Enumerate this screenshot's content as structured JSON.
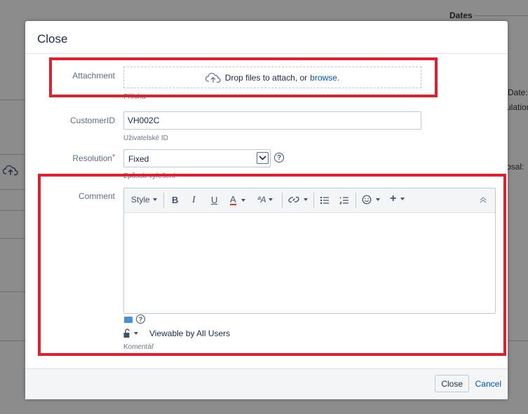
{
  "background": {
    "dates_label": "Dates",
    "date_partial": "Date:",
    "simul_partial": "ulation",
    "posal_partial": "osal:"
  },
  "dialog": {
    "title": "Close",
    "attachment": {
      "label": "Attachment",
      "drop_text": "Drop files to attach, or",
      "browse_link": "browse.",
      "hint": "Příloha"
    },
    "customer_id": {
      "label": "CustomerID",
      "value": "VH002C",
      "hint": "Uživatelské ID"
    },
    "resolution": {
      "label": "Resolution",
      "required_marker": "*",
      "selected": "Fixed",
      "hint": "Způsob vyřešení"
    },
    "comment": {
      "label": "Comment",
      "toolbar": {
        "style_label": "Style",
        "bold": "B",
        "italic": "I",
        "underline": "U",
        "text_color": "A",
        "more_formatting": "ªA",
        "link": "link-icon",
        "bullet_list": "bullet-list-icon",
        "numbered_list": "numbered-list-icon",
        "emoticon": "emoticon-icon",
        "insert": "+",
        "collapse": "collapse-icon"
      },
      "help_mark": "?",
      "visibility": "Viewable by All Users",
      "hint": "Komentář"
    },
    "footer": {
      "close_button": "Close",
      "cancel_link": "Cancel"
    }
  },
  "colors": {
    "highlight": "#e0202e",
    "link": "#0052cc",
    "text_color_underline": "#de350b"
  }
}
